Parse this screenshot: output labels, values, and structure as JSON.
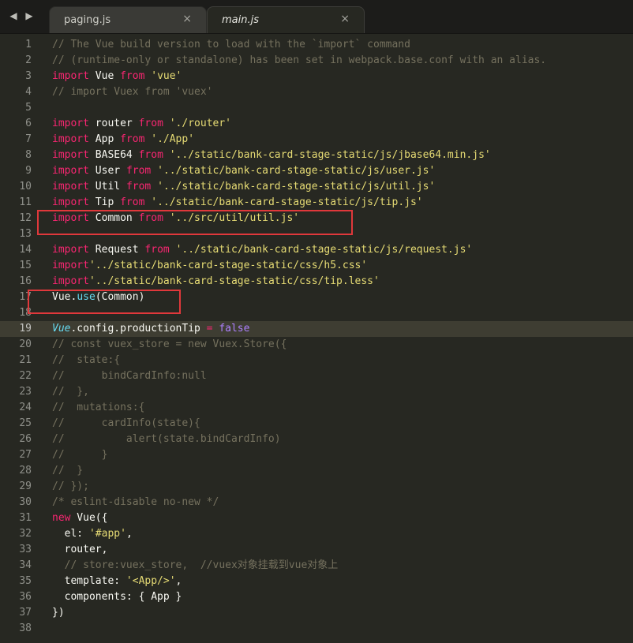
{
  "tabs": [
    {
      "label": "paging.js",
      "active": false,
      "close": "×"
    },
    {
      "label": "main.js",
      "active": true,
      "close": "×"
    }
  ],
  "nav": {
    "back": "◀",
    "forward": "▶"
  },
  "colors": {
    "background": "#272822",
    "keyword": "#f92672",
    "string": "#e6db74",
    "comment": "#75715e",
    "function": "#66d9ef",
    "boolean": "#ae81ff",
    "highlight_box": "#e0383b"
  },
  "current_line": 19,
  "highlighted_lines": [
    12,
    17
  ],
  "lines": [
    [
      {
        "t": "cm",
        "v": "// The Vue build version to load with the `import` command"
      }
    ],
    [
      {
        "t": "cm",
        "v": "// (runtime-only or standalone) has been set in webpack.base.conf with an alias."
      }
    ],
    [
      {
        "t": "kw",
        "v": "import"
      },
      {
        "t": "",
        "v": " Vue "
      },
      {
        "t": "kw",
        "v": "from"
      },
      {
        "t": "",
        "v": " "
      },
      {
        "t": "str",
        "v": "'vue'"
      }
    ],
    [
      {
        "t": "cm",
        "v": "// import Vuex from 'vuex'"
      }
    ],
    [],
    [
      {
        "t": "kw",
        "v": "import"
      },
      {
        "t": "",
        "v": " router "
      },
      {
        "t": "kw",
        "v": "from"
      },
      {
        "t": "",
        "v": " "
      },
      {
        "t": "str",
        "v": "'./router'"
      }
    ],
    [
      {
        "t": "kw",
        "v": "import"
      },
      {
        "t": "",
        "v": " App "
      },
      {
        "t": "kw",
        "v": "from"
      },
      {
        "t": "",
        "v": " "
      },
      {
        "t": "str",
        "v": "'./App'"
      }
    ],
    [
      {
        "t": "kw",
        "v": "import"
      },
      {
        "t": "",
        "v": " BASE64 "
      },
      {
        "t": "kw",
        "v": "from"
      },
      {
        "t": "",
        "v": " "
      },
      {
        "t": "str",
        "v": "'../static/bank-card-stage-static/js/jbase64.min.js'"
      }
    ],
    [
      {
        "t": "kw",
        "v": "import"
      },
      {
        "t": "",
        "v": " User "
      },
      {
        "t": "kw",
        "v": "from"
      },
      {
        "t": "",
        "v": " "
      },
      {
        "t": "str",
        "v": "'../static/bank-card-stage-static/js/user.js'"
      }
    ],
    [
      {
        "t": "kw",
        "v": "import"
      },
      {
        "t": "",
        "v": " Util "
      },
      {
        "t": "kw",
        "v": "from"
      },
      {
        "t": "",
        "v": " "
      },
      {
        "t": "str",
        "v": "'../static/bank-card-stage-static/js/util.js'"
      }
    ],
    [
      {
        "t": "kw",
        "v": "import"
      },
      {
        "t": "",
        "v": " Tip "
      },
      {
        "t": "kw",
        "v": "from"
      },
      {
        "t": "",
        "v": " "
      },
      {
        "t": "str",
        "v": "'../static/bank-card-stage-static/js/tip.js'"
      }
    ],
    [
      {
        "t": "kw",
        "v": "import"
      },
      {
        "t": "",
        "v": " Common "
      },
      {
        "t": "kw",
        "v": "from"
      },
      {
        "t": "",
        "v": " "
      },
      {
        "t": "str",
        "v": "'../src/util/util.js'"
      }
    ],
    [],
    [
      {
        "t": "kw",
        "v": "import"
      },
      {
        "t": "",
        "v": " Request "
      },
      {
        "t": "kw",
        "v": "from"
      },
      {
        "t": "",
        "v": " "
      },
      {
        "t": "str",
        "v": "'../static/bank-card-stage-static/js/request.js'"
      }
    ],
    [
      {
        "t": "kw",
        "v": "import"
      },
      {
        "t": "str",
        "v": "'../static/bank-card-stage-static/css/h5.css'"
      }
    ],
    [
      {
        "t": "kw",
        "v": "import"
      },
      {
        "t": "str",
        "v": "'../static/bank-card-stage-static/css/tip.less'"
      }
    ],
    [
      {
        "t": "",
        "v": "Vue."
      },
      {
        "t": "fn",
        "v": "use"
      },
      {
        "t": "",
        "v": "(Common)"
      }
    ],
    [],
    [
      {
        "t": "cls",
        "v": "Vue"
      },
      {
        "t": "",
        "v": ".config.productionTip "
      },
      {
        "t": "kw",
        "v": "="
      },
      {
        "t": "",
        "v": " "
      },
      {
        "t": "num",
        "v": "false"
      }
    ],
    [
      {
        "t": "cm",
        "v": "// const vuex_store = new Vuex.Store({"
      }
    ],
    [
      {
        "t": "cm",
        "v": "//  state:{"
      }
    ],
    [
      {
        "t": "cm",
        "v": "//      bindCardInfo:null"
      }
    ],
    [
      {
        "t": "cm",
        "v": "//  },"
      }
    ],
    [
      {
        "t": "cm",
        "v": "//  mutations:{"
      }
    ],
    [
      {
        "t": "cm",
        "v": "//      cardInfo(state){"
      }
    ],
    [
      {
        "t": "cm",
        "v": "//          alert(state.bindCardInfo)"
      }
    ],
    [
      {
        "t": "cm",
        "v": "//      }"
      }
    ],
    [
      {
        "t": "cm",
        "v": "//  }"
      }
    ],
    [
      {
        "t": "cm",
        "v": "// });"
      }
    ],
    [
      {
        "t": "cm",
        "v": "/* eslint-disable no-new */"
      }
    ],
    [
      {
        "t": "kw",
        "v": "new"
      },
      {
        "t": "",
        "v": " Vue({"
      }
    ],
    [
      {
        "t": "",
        "v": "  el: "
      },
      {
        "t": "str",
        "v": "'#app'"
      },
      {
        "t": "",
        "v": ","
      }
    ],
    [
      {
        "t": "",
        "v": "  router,"
      }
    ],
    [
      {
        "t": "",
        "v": "  "
      },
      {
        "t": "cm",
        "v": "// store:vuex_store,  //vuex对象挂载到vue对象上"
      }
    ],
    [
      {
        "t": "",
        "v": "  template: "
      },
      {
        "t": "str",
        "v": "'<App/>'"
      },
      {
        "t": "",
        "v": ","
      }
    ],
    [
      {
        "t": "",
        "v": "  components: { App }"
      }
    ],
    [
      {
        "t": "",
        "v": "})"
      }
    ],
    []
  ]
}
